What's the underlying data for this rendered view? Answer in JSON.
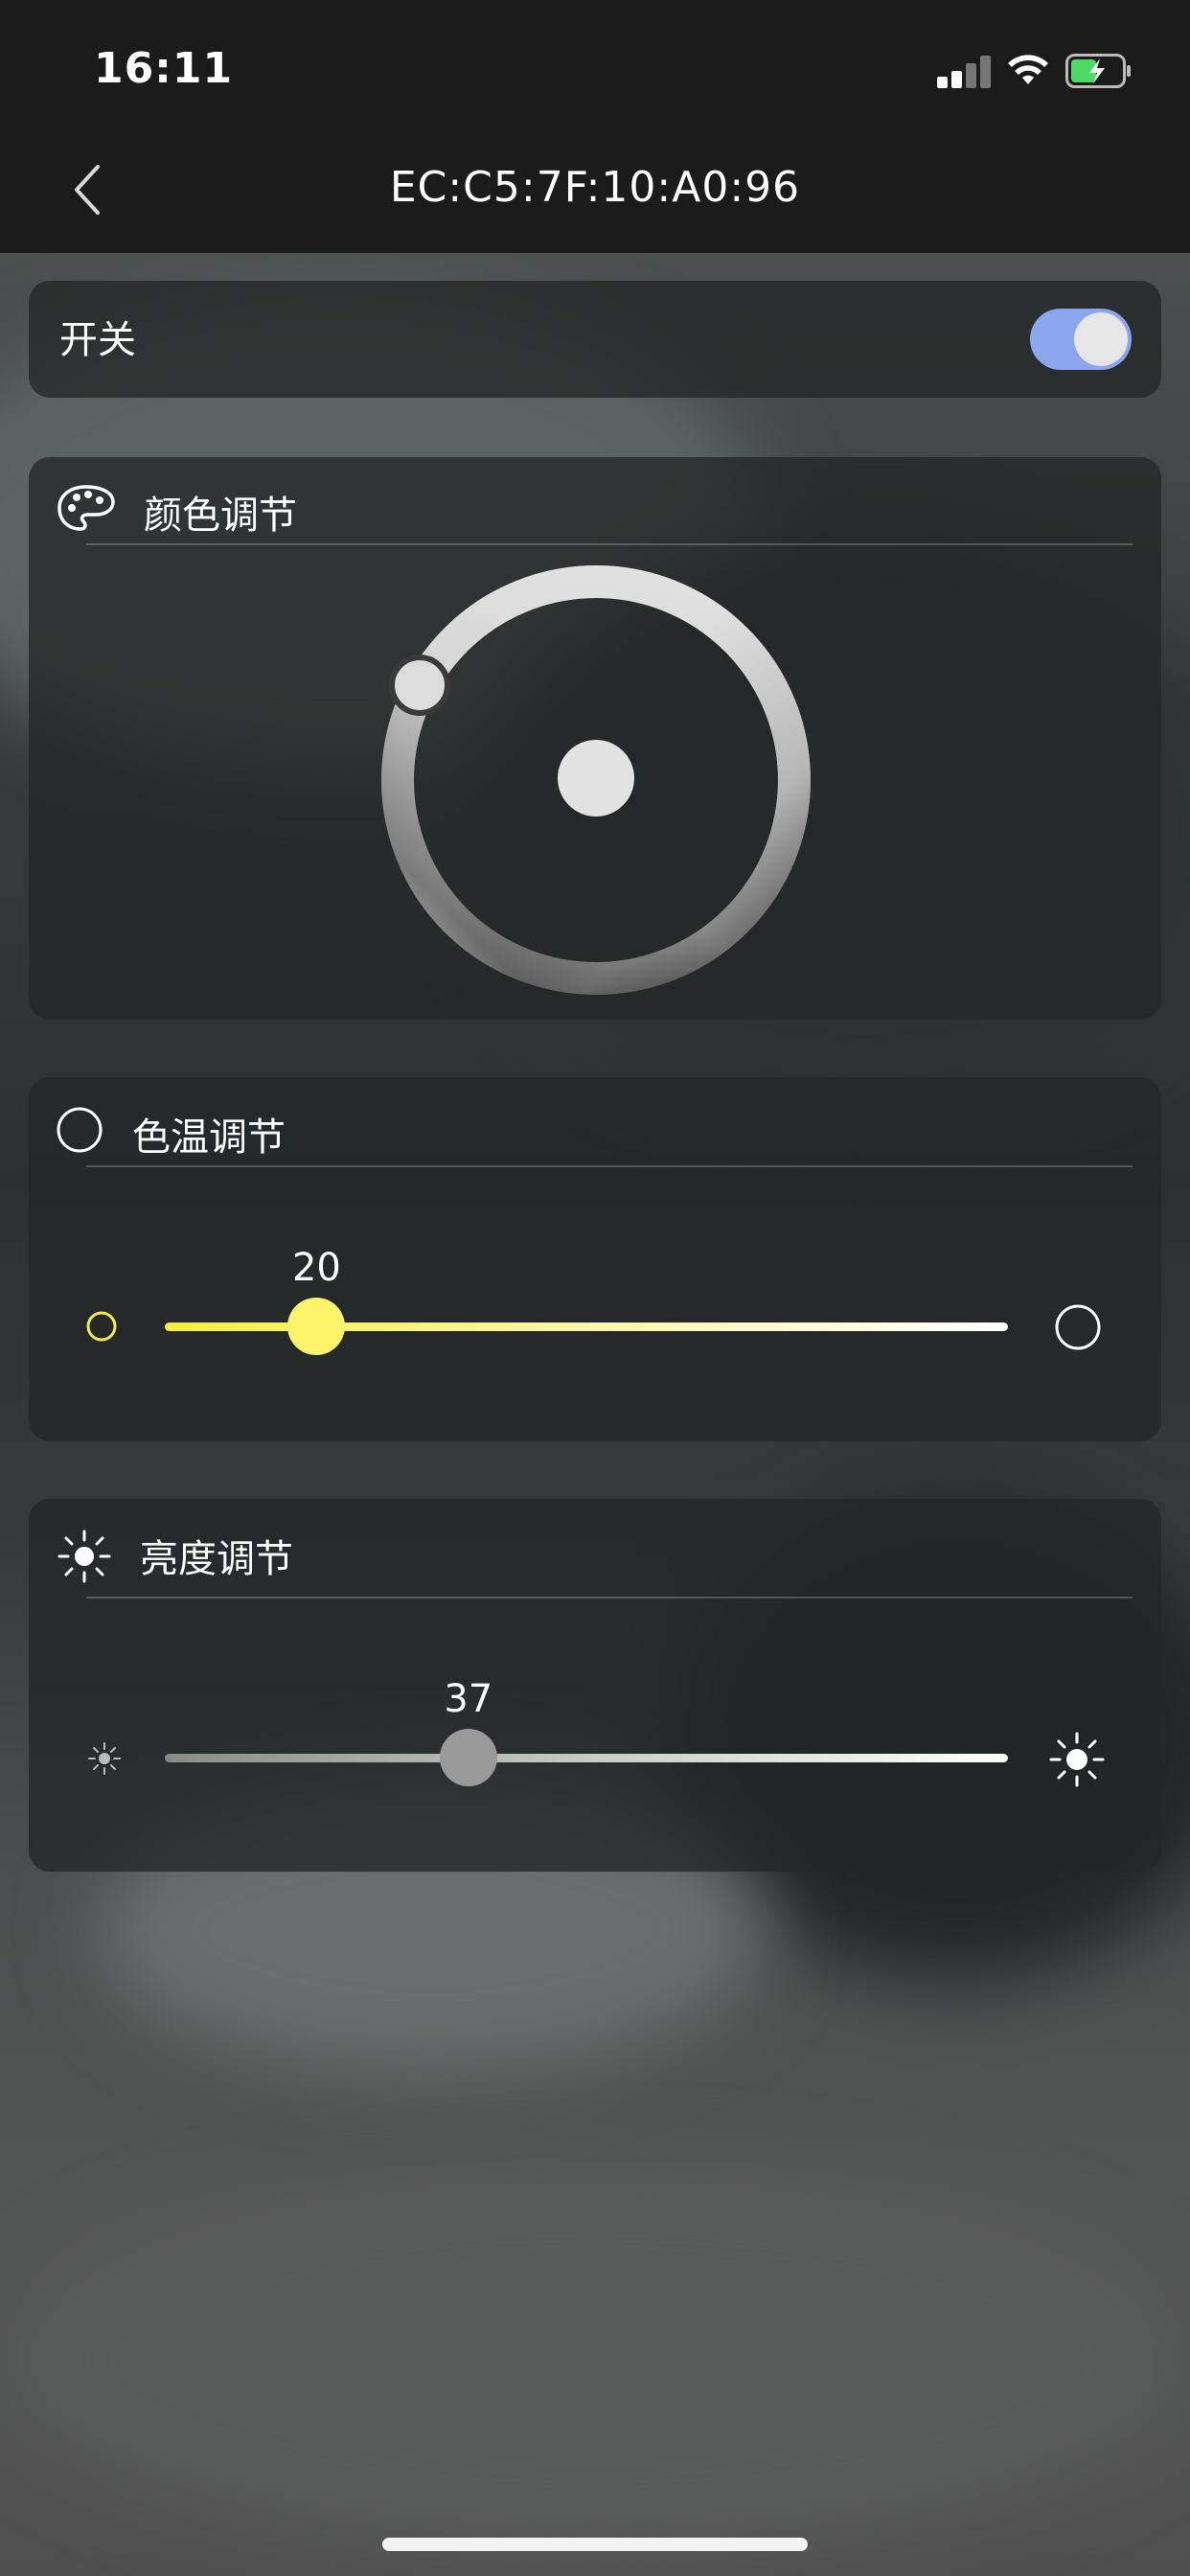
{
  "status": {
    "time": "16:11"
  },
  "nav": {
    "title": "EC:C5:7F:10:A0:96"
  },
  "power": {
    "label": "开关",
    "on": true
  },
  "color_panel": {
    "label": "颜色调节"
  },
  "color_temp": {
    "label": "色温调节",
    "value": "20",
    "fraction": 0.18
  },
  "brightness": {
    "label": "亮度调节",
    "value": "37",
    "fraction": 0.36
  },
  "colors": {
    "toggle_on": "#8ba6ec",
    "temp_accent": "#fff36a",
    "card_bg": "rgba(35,38,38,0.78)"
  },
  "icons": [
    "back-chevron-icon",
    "palette-icon",
    "circle-icon",
    "sun-icon",
    "small-sun-icon",
    "large-sun-icon"
  ]
}
